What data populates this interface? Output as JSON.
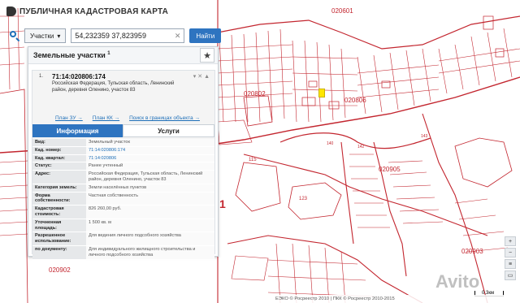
{
  "header": {
    "title": "ПУБЛИЧНАЯ КАДАСТРОВАЯ КАРТА"
  },
  "search": {
    "type_label": "Участки",
    "value": "54,232359 37,823959",
    "find_label": "Найти"
  },
  "panel": {
    "title": "Земельные участки",
    "count_sup": "1",
    "item_number": "1.",
    "cad_number": "71:14:020806:174",
    "address": "Российская Федерация, Тульская область, Ленинский район, деревня Оленино, участок 83",
    "controls": "▾✕▲",
    "links": [
      "План ЗУ →",
      "План КК →",
      "Поиск в границах объекта →"
    ],
    "tabs": [
      "Информация",
      "Услуги"
    ],
    "rows": [
      {
        "key": "Вид:",
        "value": "Земельный участок"
      },
      {
        "key": "Кад. номер:",
        "value": "71:14:020806:174"
      },
      {
        "key": "Кад. квартал:",
        "value": "71:14:020806"
      },
      {
        "key": "Статус:",
        "value": "Ранее учтенный"
      },
      {
        "key": "Адрес:",
        "value": "Российская Федерация, Тульская область, Ленинский район, деревня Оленино, участок 83"
      },
      {
        "key": "Категория земель:",
        "value": "Земли населённых пунктов"
      },
      {
        "key": "Форма собственности:",
        "value": "Частная собственность"
      },
      {
        "key": "Кадастровая стоимость:",
        "value": "826 260,00 руб."
      },
      {
        "key": "Уточненная площадь:",
        "value": "1 500 кв. м"
      },
      {
        "key": "Разрешенное использование:",
        "value": "Для ведения личного подсобного хозяйства"
      },
      {
        "key": "по документу:",
        "value": "Для индивидуального жилищного строительства и личного подсобного хозяйства"
      }
    ]
  },
  "map": {
    "labels": [
      "020601",
      "020806",
      "020905",
      "020902",
      "020802",
      "020903",
      "115",
      "123",
      "1"
    ],
    "parcel_numbers": [
      "143",
      "142",
      "140"
    ],
    "highlight_color": "#ffe600",
    "boundary_color": "#c3262f"
  },
  "footer": {
    "text": "ЕЭКО © Росреестр 2010 | ПКК © Росреестр 2010-2015",
    "scale": "0.3км"
  },
  "watermark": "Avito"
}
